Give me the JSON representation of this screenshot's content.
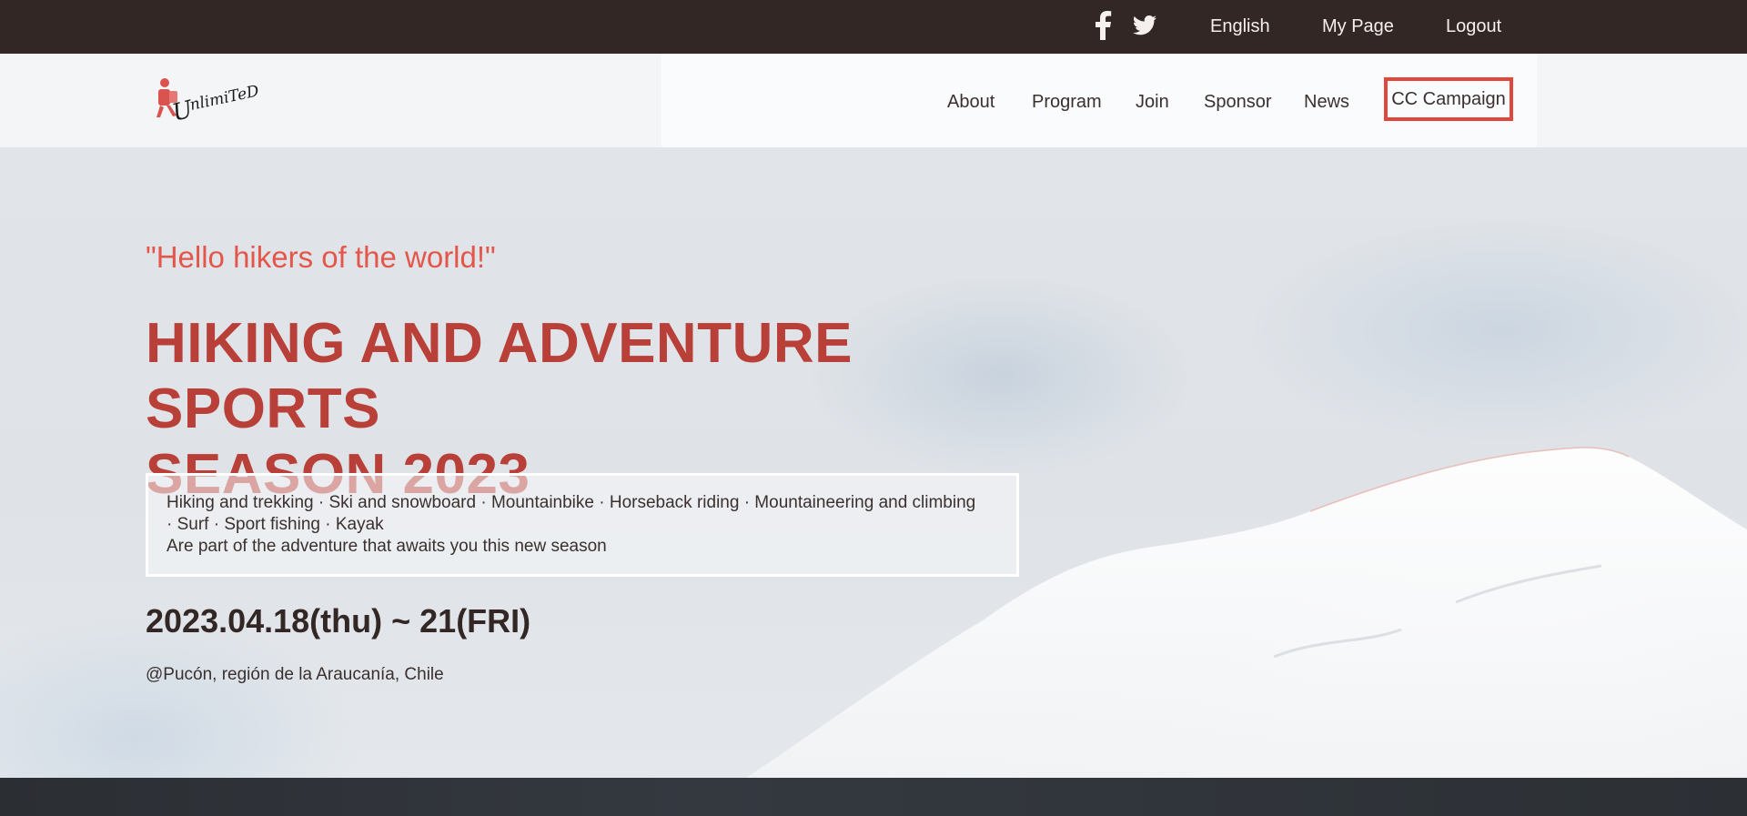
{
  "topbar": {
    "social": [
      "facebook-icon",
      "twitter-icon"
    ],
    "links": {
      "language": "English",
      "mypage": "My Page",
      "logout": "Logout"
    }
  },
  "navbar": {
    "logo_text": "Unlimited",
    "items": {
      "about": "About",
      "program": "Program",
      "join": "Join",
      "sponsor": "Sponsor",
      "news": "News",
      "campaign": "CC Campaign"
    }
  },
  "hero": {
    "greeting": "\"Hello hikers of the world!\"",
    "headline_line1": "HIKING AND ADVENTURE SPORTS",
    "headline_line2": "SEASON 2023",
    "activities_line1": "Hiking and trekking · Ski and snowboard · Mountainbike · Horseback riding · Mountaineering and climbing",
    "activities_line2": "· Surf · Sport fishing · Kayak",
    "activities_line3": "Are part of the adventure that awaits you this new season",
    "dates": "2023.04.18(thu) ~ 21(FRI)",
    "location": "@Pucón, región de la Araucanía, Chile"
  },
  "colors": {
    "topbar_bg": "#322725",
    "accent": "#e0473d",
    "headline": "#b94038"
  }
}
